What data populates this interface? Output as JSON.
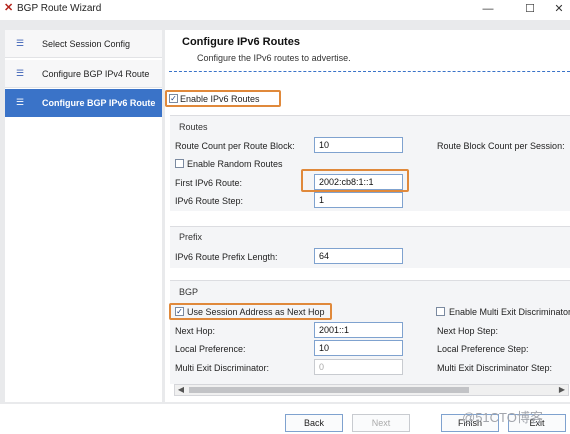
{
  "window": {
    "title": "BGP Route Wizard",
    "controls": {
      "minimize": "—",
      "maximize": "☐",
      "close": "✕"
    }
  },
  "sidebar": {
    "items": [
      {
        "label": "Select Session Config",
        "icon": "list-icon"
      },
      {
        "label": "Configure BGP IPv4 Route",
        "icon": "list-icon"
      },
      {
        "label": "Configure BGP IPv6 Route",
        "icon": "list-icon",
        "active": true
      }
    ]
  },
  "header": {
    "title": "Configure IPv6 Routes",
    "subtitle": "Configure the IPv6 routes to advertise."
  },
  "enable": {
    "label": "Enable IPv6 Routes",
    "checked": true
  },
  "routes": {
    "title": "Routes",
    "count_label": "Route Count per Route Block:",
    "count_value": "10",
    "block_count_label": "Route Block Count per Session:",
    "random_label": "Enable Random Routes",
    "first_label": "First IPv6 Route:",
    "first_value": "2002:cb8:1::1",
    "step_label": "IPv6 Route Step:",
    "step_value": "1"
  },
  "prefix": {
    "title": "Prefix",
    "length_label": "IPv6 Route Prefix Length:",
    "length_value": "64"
  },
  "bgp": {
    "title": "BGP",
    "use_session_label": "Use Session Address as Next Hop",
    "multi_exit_enable_label": "Enable Multi Exit Discriminator",
    "next_hop_label": "Next Hop:",
    "next_hop_value": "2001::1",
    "next_hop_step_label": "Next Hop Step:",
    "local_pref_label": "Local Preference:",
    "local_pref_value": "10",
    "local_pref_step_label": "Local Preference Step:",
    "med_label": "Multi Exit Discriminator:",
    "med_value": "0",
    "med_step_label": "Multi Exit Discriminator Step:"
  },
  "buttons": {
    "back": "Back",
    "next": "Next",
    "finish": "Finish",
    "exit": "Exit"
  },
  "watermark": "@51CTO博客",
  "colors": {
    "accent": "#3a73c8",
    "highlight": "#e0893b"
  }
}
